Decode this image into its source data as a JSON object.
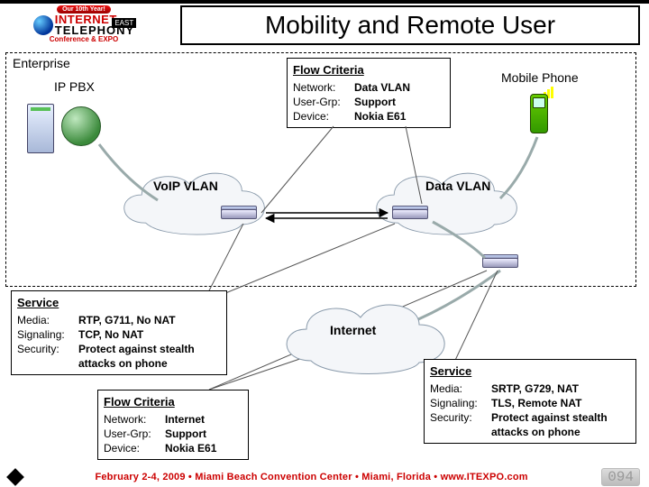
{
  "logo": {
    "banner": "Our 10th Year!",
    "brand_top": "INTERNET",
    "brand_bot": "TELEPHONY",
    "sub": "Conference & EXPO",
    "east": "EAST"
  },
  "title": "Mobility and Remote User",
  "enterprise_label": "Enterprise",
  "ip_pbx_label": "IP PBX",
  "mobile_phone_label": "Mobile Phone",
  "voip_vlan_label": "VoIP VLAN",
  "data_vlan_label": "Data VLAN",
  "internet_label": "Internet",
  "flow_top": {
    "heading": "Flow Criteria",
    "network_k": "Network:",
    "network_v": "Data VLAN",
    "usergrp_k": "User-Grp:",
    "usergrp_v": "Support",
    "device_k": "Device:",
    "device_v": "Nokia E61"
  },
  "flow_bottom": {
    "heading": "Flow Criteria",
    "network_k": "Network:",
    "network_v": "Internet",
    "usergrp_k": "User-Grp:",
    "usergrp_v": "Support",
    "device_k": "Device:",
    "device_v": "Nokia E61"
  },
  "service_left": {
    "heading": "Service",
    "media_k": "Media:",
    "media_v": "RTP, G711, No NAT",
    "sig_k": "Signaling:",
    "sig_v": "TCP, No NAT",
    "sec_k": "Security:",
    "sec_v": "Protect against stealth attacks on phone"
  },
  "service_right": {
    "heading": "Service",
    "media_k": "Media:",
    "media_v": "SRTP, G729, NAT",
    "sig_k": "Signaling:",
    "sig_v": "TLS, Remote NAT",
    "sec_k": "Security:",
    "sec_v": "Protect against stealth attacks on phone"
  },
  "footer": {
    "text": "February 2-4, 2009 • Miami Beach Convention Center • Miami, Florida • www.ITEXPO.com",
    "slide_no": "094"
  }
}
